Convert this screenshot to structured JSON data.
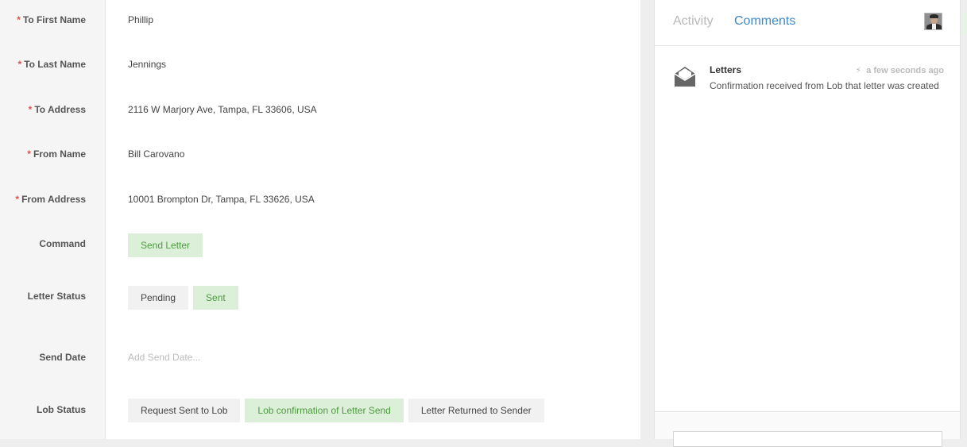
{
  "form": {
    "fields": [
      {
        "label": "To First Name",
        "required": "*",
        "value": "Phillip"
      },
      {
        "label": "To Last Name",
        "required": "*",
        "value": "Jennings"
      },
      {
        "label": "To Address",
        "required": "*",
        "value": "2116 W Marjory Ave, Tampa, FL 33606, USA"
      },
      {
        "label": "From Name",
        "required": "*",
        "value": "Bill Carovano"
      },
      {
        "label": "From Address",
        "required": "*",
        "value": "10001 Brompton Dr, Tampa, FL 33626, USA"
      }
    ],
    "command": {
      "label": "Command",
      "button": "Send Letter"
    },
    "letter_status": {
      "label": "Letter Status",
      "options": [
        "Pending",
        "Sent"
      ],
      "selected": "Sent"
    },
    "send_date": {
      "label": "Send Date",
      "placeholder": "Add Send Date..."
    },
    "lob_status": {
      "label": "Lob Status",
      "options": [
        "Request Sent to Lob",
        "Lob confirmation of Letter Send",
        "Letter Returned to Sender"
      ],
      "selected": "Lob confirmation of Letter Send"
    }
  },
  "side": {
    "tabs": [
      "Activity",
      "Comments"
    ],
    "active_tab": "Comments",
    "entries": [
      {
        "icon": "envelope-open-icon",
        "title": "Letters",
        "time": "a few seconds ago",
        "text": "Confirmation received from Lob that letter was created"
      }
    ]
  },
  "colors": {
    "accent": "#3f89c8",
    "active_chip_bg": "#dcefd8",
    "active_chip_text": "#4d9a40",
    "required": "#d9534f"
  }
}
